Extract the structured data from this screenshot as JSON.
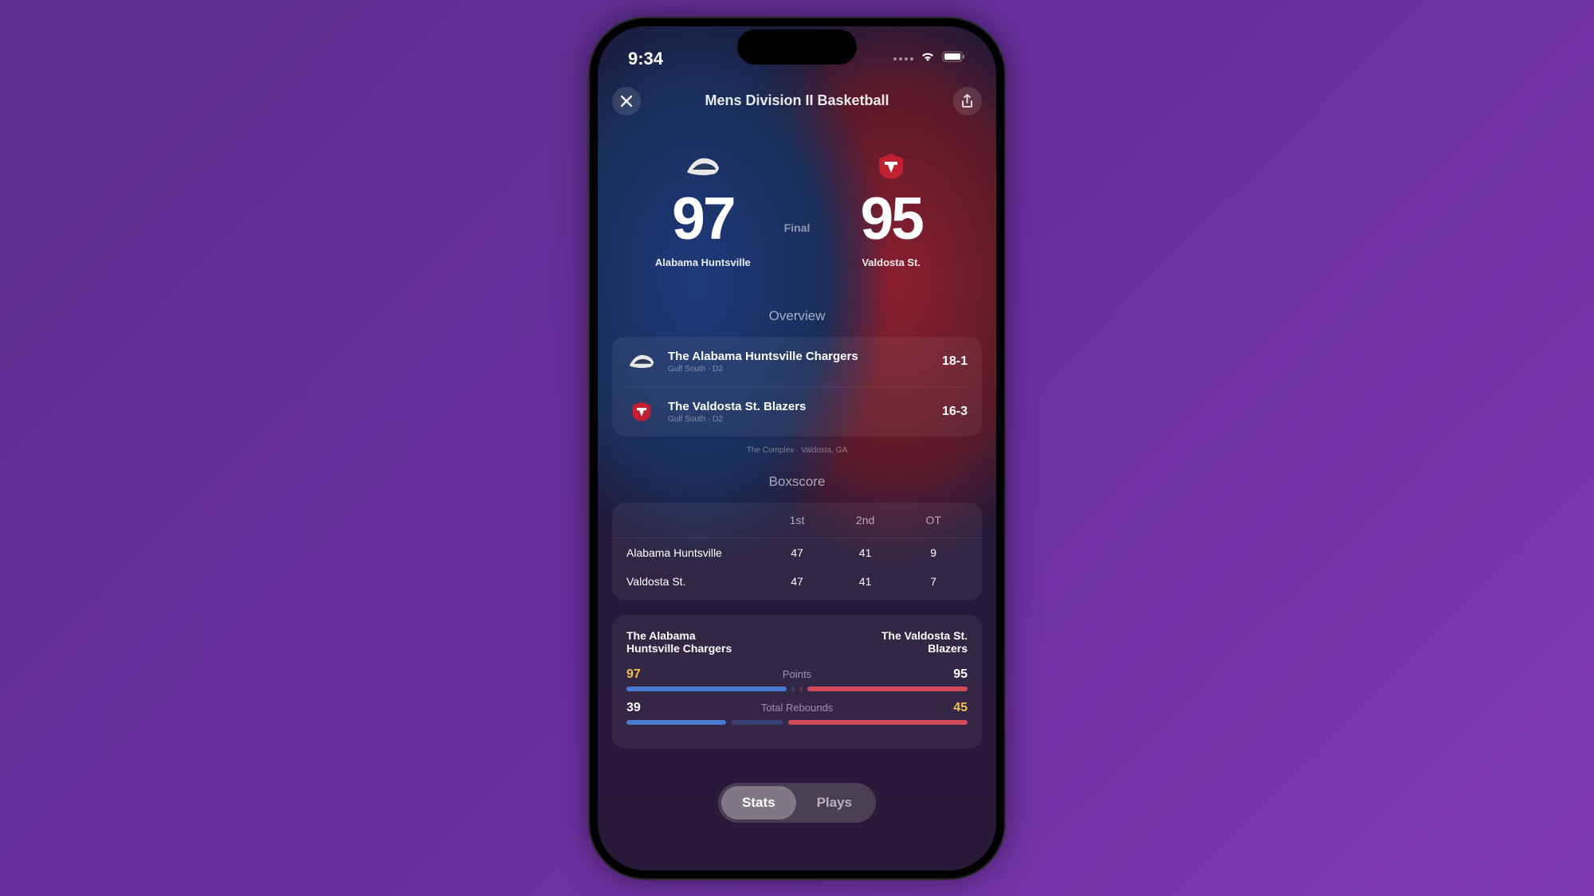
{
  "status": {
    "time": "9:34"
  },
  "header": {
    "title": "Mens Division II Basketball"
  },
  "game": {
    "home": {
      "score": "97",
      "name": "Alabama Huntsville"
    },
    "away": {
      "score": "95",
      "name": "Valdosta St."
    },
    "status": "Final"
  },
  "overview": {
    "title": "Overview",
    "teams": [
      {
        "name": "The Alabama Huntsville Chargers",
        "conference": "Gulf South",
        "division": "D2",
        "record": "18-1"
      },
      {
        "name": "The Valdosta St. Blazers",
        "conference": "Gulf South",
        "division": "D2",
        "record": "16-3"
      }
    ],
    "venue": "The Complex · Valdosta, GA"
  },
  "boxscore": {
    "title": "Boxscore",
    "periods": [
      "1st",
      "2nd",
      "OT"
    ],
    "rows": [
      {
        "team": "Alabama Huntsville",
        "scores": [
          "47",
          "41",
          "9"
        ]
      },
      {
        "team": "Valdosta St.",
        "scores": [
          "47",
          "41",
          "7"
        ]
      }
    ]
  },
  "stats": {
    "team_left": "The Alabama Huntsville Chargers",
    "team_right": "The Valdosta St. Blazers",
    "rows": [
      {
        "label": "Points",
        "left": "97",
        "right": "95",
        "left_winner": true,
        "left_pct": 51,
        "right_pct": 49
      },
      {
        "label": "Total Rebounds",
        "left": "39",
        "right": "45",
        "left_winner": false,
        "left_pct": 46,
        "right_pct": 54
      }
    ]
  },
  "tabs": {
    "stats": "Stats",
    "plays": "Plays"
  }
}
